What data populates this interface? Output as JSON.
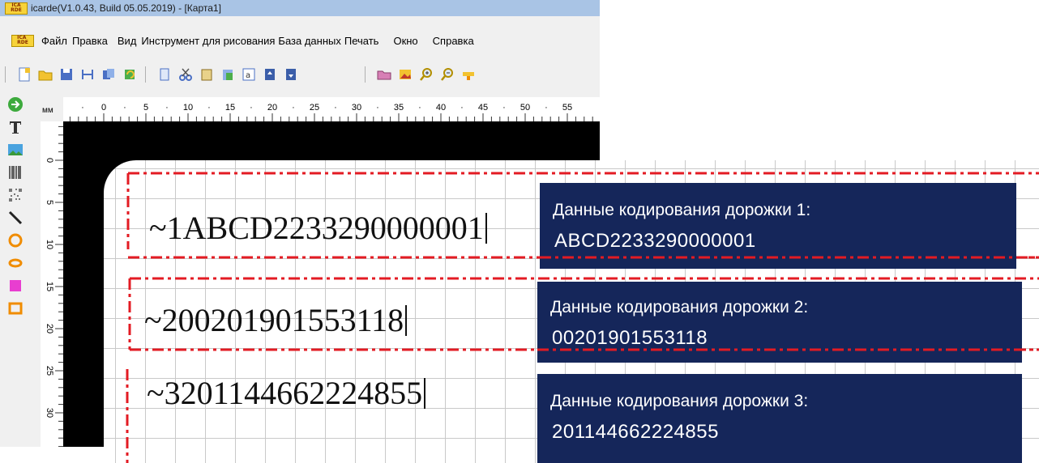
{
  "window": {
    "title": "icarde(V1.0.43, Build 05.05.2019) - [Карта1]",
    "logo_text": "ICARDE"
  },
  "menu": {
    "items": [
      "Файл",
      "Правка",
      "Вид",
      "Инструмент для рисования",
      "База данных",
      "Печать",
      "Окно",
      "Справка"
    ]
  },
  "toolbar": {
    "icons": [
      "new-file-icon",
      "open-folder-icon",
      "save-icon",
      "print-preview-icon",
      "copy-format-icon",
      "undo-icon",
      "paste-icon",
      "cut-icon",
      "clipboard-icon",
      "paste-special-icon",
      "text-frame-icon",
      "bring-front-icon",
      "send-back-icon",
      "folder-icon",
      "image-icon",
      "zoom-in-icon",
      "zoom-out-icon",
      "highlight-icon"
    ]
  },
  "ruler": {
    "unit": "мм",
    "h_labels": [
      "0",
      "5",
      "10",
      "15",
      "20",
      "25",
      "30",
      "35",
      "40",
      "45",
      "50",
      "55"
    ],
    "v_labels": [
      "0",
      "5",
      "10",
      "15",
      "20",
      "25",
      "30"
    ]
  },
  "tracks": [
    {
      "text": "~1ABCD2233290000001",
      "callout_label": "Данные кодирования дорожки 1:",
      "callout_value": "ABCD2233290000001"
    },
    {
      "text": "~200201901553118",
      "callout_label": "Данные кодирования дорожки 2:",
      "callout_value": "00201901553118"
    },
    {
      "text": "~3201144662224855",
      "callout_label": "Данные кодирования дорожки 3:",
      "callout_value": "201144662224855"
    }
  ],
  "colors": {
    "callout_bg": "#15265a",
    "dash_red": "#e31b23"
  }
}
